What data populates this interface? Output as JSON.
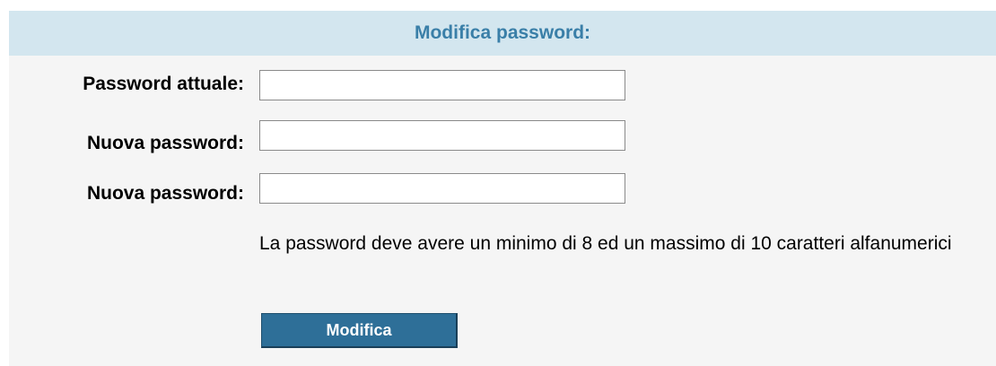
{
  "form": {
    "title": "Modifica password:",
    "fields": [
      {
        "label": "Password attuale:",
        "value": "",
        "type": "password"
      },
      {
        "label": "Nuova password:",
        "value": "",
        "type": "password"
      },
      {
        "label": "Nuova password:",
        "value": "",
        "type": "password"
      }
    ],
    "hint": "La password deve avere un minimo di 8 ed un massimo di 10 caratteri alfanumerici",
    "submit_label": "Modifica"
  },
  "colors": {
    "header_bg": "#d3e6ef",
    "header_text": "#3a7fa8",
    "panel_bg": "#f5f5f5",
    "button_bg": "#2e6f98",
    "button_text": "#ffffff"
  }
}
